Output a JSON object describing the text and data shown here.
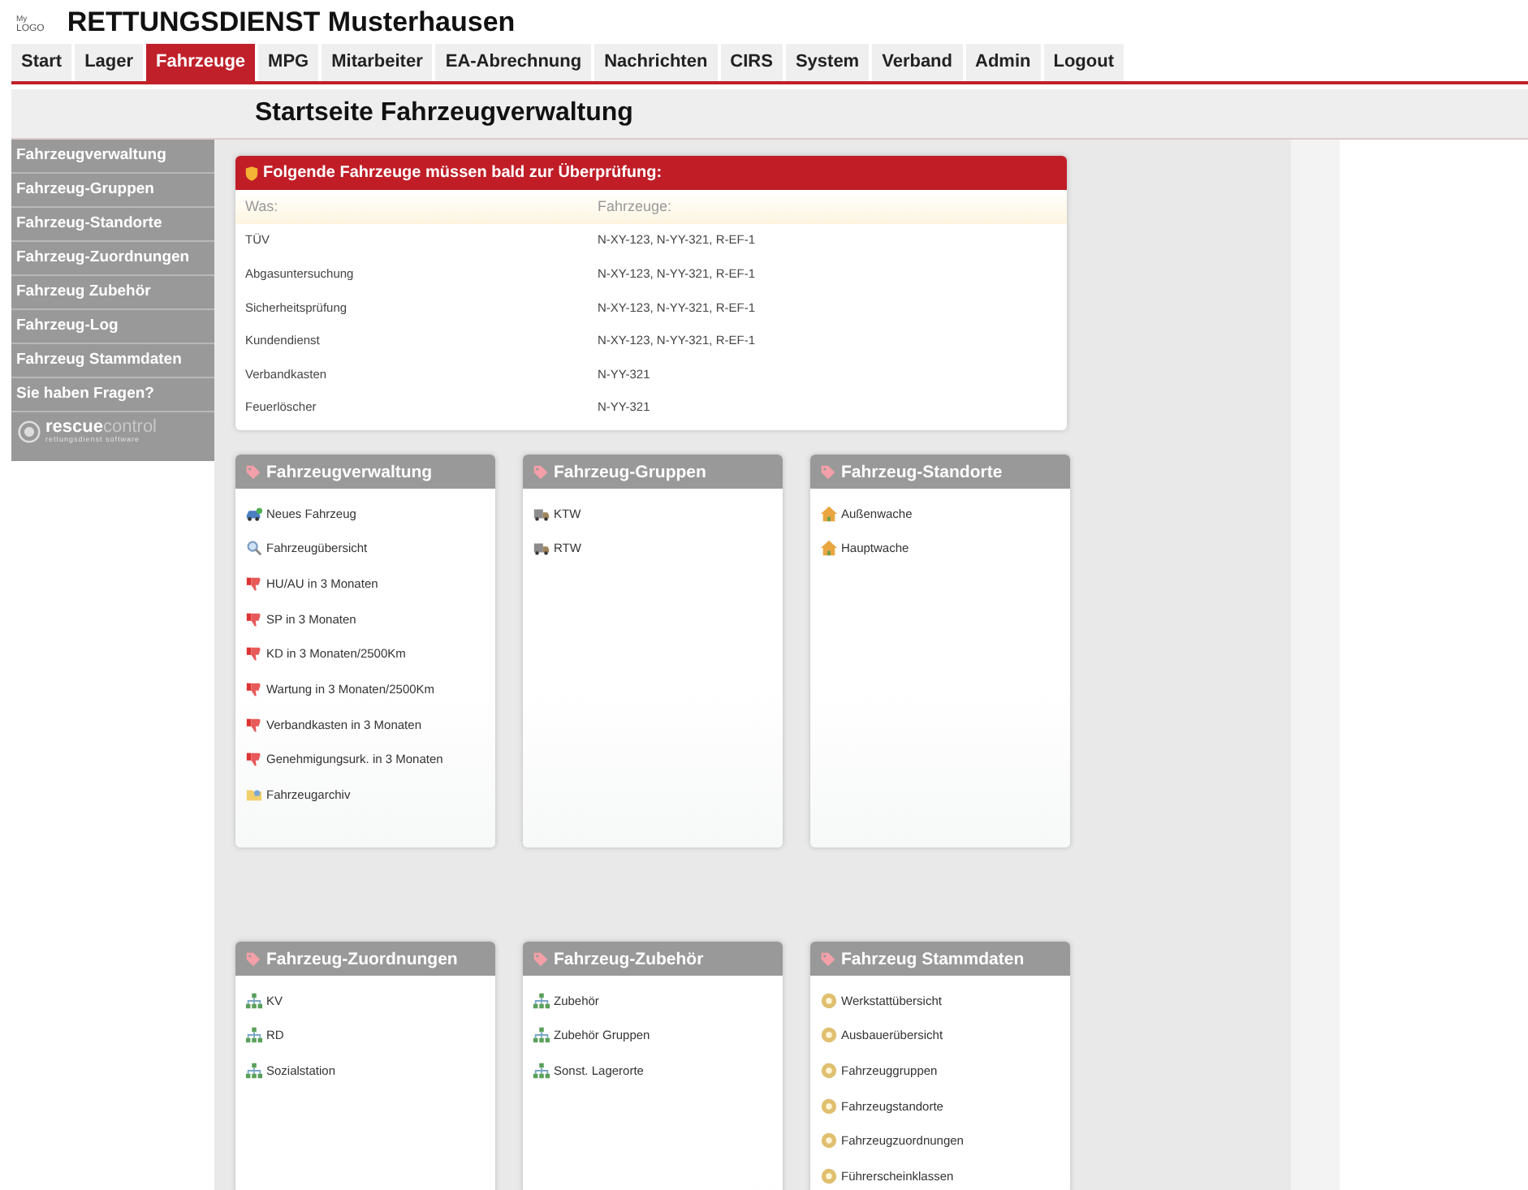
{
  "logo": {
    "line_1": "My",
    "line_2": "LOGO"
  },
  "header": {
    "title": "RETTUNGSDIENST Musterhausen"
  },
  "nav": [
    {
      "label": "Start",
      "selected": false
    },
    {
      "label": "Lager",
      "selected": false
    },
    {
      "label": "Fahrzeuge",
      "selected": true
    },
    {
      "label": "MPG",
      "selected": false
    },
    {
      "label": "Mitarbeiter",
      "selected": false
    },
    {
      "label": "EA-Abrechnung",
      "selected": false
    },
    {
      "label": "Nachrichten",
      "selected": false
    },
    {
      "label": "CIRS",
      "selected": false
    },
    {
      "label": "System",
      "selected": false
    },
    {
      "label": "Verband",
      "selected": false
    },
    {
      "label": "Admin",
      "selected": false
    },
    {
      "label": "Logout",
      "selected": false
    }
  ],
  "page_heading": "Startseite Fahrzeugverwaltung",
  "sidebar": {
    "items": [
      "Fahrzeugverwaltung",
      "Fahrzeug-Gruppen",
      "Fahrzeug-Standorte",
      "Fahrzeug-Zuordnungen",
      "Fahrzeug Zubehör",
      "Fahrzeug-Log",
      "Fahrzeug Stammdaten",
      "Sie haben Fragen?"
    ],
    "brand": {
      "part_1": "rescue",
      "part_2": "control",
      "tagline": "rettungsdienst software"
    }
  },
  "alert": {
    "title": "Folgende Fahrzeuge müssen bald zur Überprüfung:",
    "columns": [
      "Was:",
      "Fahrzeuge:"
    ],
    "rows": [
      [
        "TÜV",
        "N-XY-123, N-YY-321, R-EF-1"
      ],
      [
        "Abgasuntersuchung",
        "N-XY-123, N-YY-321, R-EF-1"
      ],
      [
        "Sicherheitsprüfung",
        "N-XY-123, N-YY-321, R-EF-1"
      ],
      [
        "Kundendienst",
        "N-XY-123, N-YY-321, R-EF-1"
      ],
      [
        "Verbandkasten",
        "N-YY-321"
      ],
      [
        "Feuerlöscher",
        "N-YY-321"
      ]
    ]
  },
  "cards": [
    {
      "title": "Fahrzeugverwaltung",
      "items": [
        {
          "label": "Neues Fahrzeug",
          "kind": "create"
        },
        {
          "label": "Fahrzeugübersicht",
          "kind": "search"
        },
        {
          "label": "HU/AU in 3 Monaten",
          "kind": "due"
        },
        {
          "label": "SP in 3 Monaten",
          "kind": "due"
        },
        {
          "label": "KD in 3 Monaten/2500Km",
          "kind": "due"
        },
        {
          "label": "Wartung in 3 Monaten/2500Km",
          "kind": "due"
        },
        {
          "label": "Verbandkasten in 3 Monaten",
          "kind": "due"
        },
        {
          "label": "Genehmigungsurk. in 3 Monaten",
          "kind": "due"
        },
        {
          "label": "Fahrzeugarchiv",
          "kind": "archive"
        }
      ]
    },
    {
      "title": "Fahrzeug-Gruppen",
      "items": [
        {
          "label": "KTW",
          "kind": "group"
        },
        {
          "label": "RTW",
          "kind": "group"
        }
      ]
    },
    {
      "title": "Fahrzeug-Standorte",
      "items": [
        {
          "label": "Außenwache",
          "kind": "location"
        },
        {
          "label": "Hauptwache",
          "kind": "location"
        }
      ]
    },
    {
      "title": "Fahrzeug-Zuordnungen",
      "items": [
        {
          "label": "KV",
          "kind": "assignment"
        },
        {
          "label": "RD",
          "kind": "assignment"
        },
        {
          "label": "Sozialstation",
          "kind": "assignment"
        }
      ]
    },
    {
      "title": "Fahrzeug-Zubehör",
      "items": [
        {
          "label": "Zubehör",
          "kind": "assignment"
        },
        {
          "label": "Zubehör Gruppen",
          "kind": "assignment"
        },
        {
          "label": "Sonst. Lagerorte",
          "kind": "assignment"
        }
      ]
    },
    {
      "title": "Fahrzeug Stammdaten",
      "items": [
        {
          "label": "Werkstattübersicht",
          "kind": "masterdata"
        },
        {
          "label": "Ausbauerübersicht",
          "kind": "masterdata"
        },
        {
          "label": "Fahrzeuggruppen",
          "kind": "masterdata"
        },
        {
          "label": "Fahrzeugstandorte",
          "kind": "masterdata"
        },
        {
          "label": "Fahrzeugzuordnungen",
          "kind": "masterdata"
        },
        {
          "label": "Führerscheinklassen",
          "kind": "masterdata"
        }
      ]
    }
  ]
}
